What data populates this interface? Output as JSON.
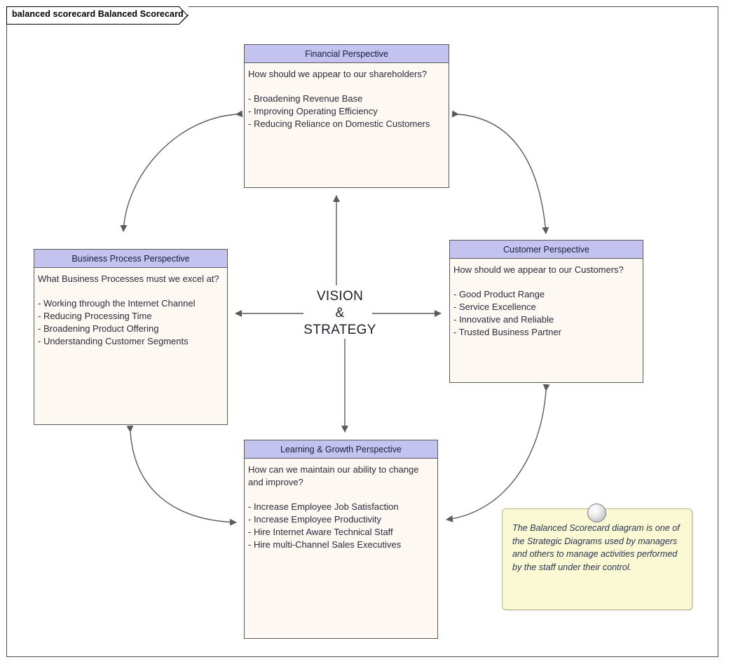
{
  "window": {
    "tab_title": "balanced scorecard Balanced Scorecard"
  },
  "diagram": {
    "center_label_line1": "VISION",
    "center_label_line2": "&",
    "center_label_line3": "STRATEGY",
    "colors": {
      "header_fill": "#c4c2ef",
      "body_fill": "#fdf8f2",
      "border": "#5a5a5a",
      "connector": "#5a5a5a",
      "note_fill": "#fbf8d4",
      "note_border": "#b9b78e"
    },
    "perspectives": [
      {
        "id": "financial",
        "title": "Financial Perspective",
        "question": "How should we appear to our shareholders?",
        "items": [
          "- Broadening Revenue Base",
          "- Improving Operating Efficiency",
          "- Reducing Reliance on Domestic Customers"
        ]
      },
      {
        "id": "business-process",
        "title": "Business Process Perspective",
        "question": "What Business Processes must we excel at?",
        "items": [
          "- Working through the Internet Channel",
          "- Reducing Processing Time",
          "- Broadening Product Offering",
          "- Understanding Customer Segments"
        ]
      },
      {
        "id": "customer",
        "title": "Customer Perspective",
        "question": "How should we appear to our Customers?",
        "items": [
          "- Good Product Range",
          "- Service Excellence",
          "- Innovative and Reliable",
          "- Trusted Business Partner"
        ]
      },
      {
        "id": "learning-growth",
        "title": "Learning & Growth Perspective",
        "question": "How can we maintain our ability to change and improve?",
        "items": [
          "- Increase Employee Job Satisfaction",
          "- Increase Employee Productivity",
          "- Hire Internet Aware Technical Staff",
          "- Hire multi-Channel Sales Executives"
        ]
      }
    ],
    "note": {
      "text": "The Balanced Scorecard diagram is one of the Strategic Diagrams used by managers and others to manage activities performed by the staff under their control."
    }
  }
}
